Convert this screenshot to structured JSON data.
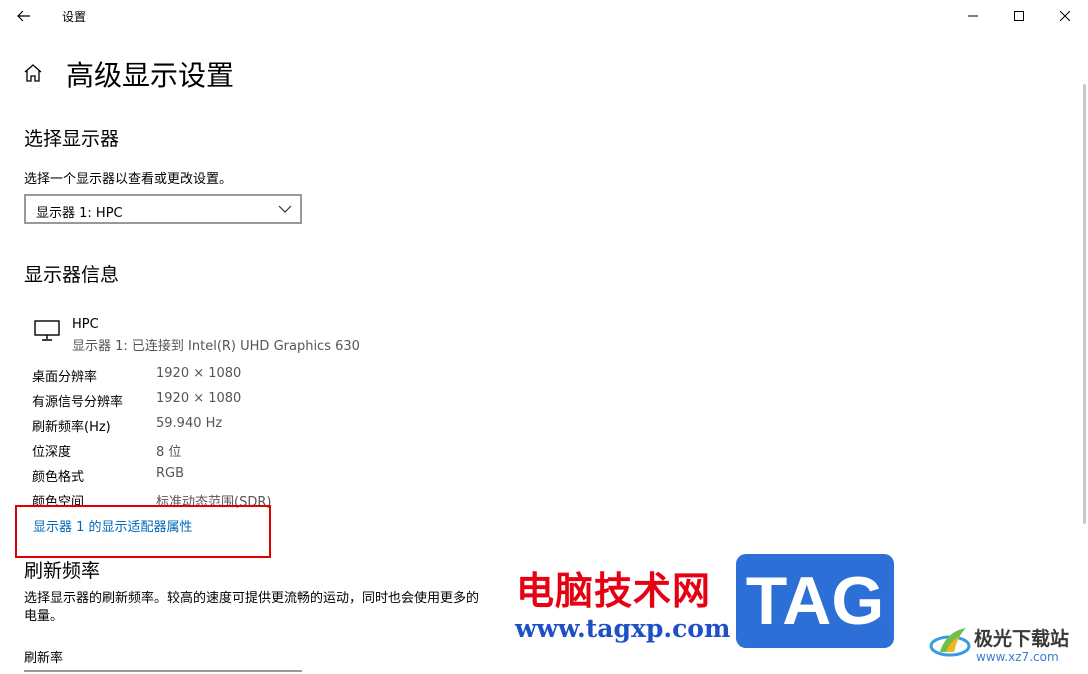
{
  "window": {
    "title": "设置"
  },
  "page": {
    "title": "高级显示设置"
  },
  "select_display": {
    "heading": "选择显示器",
    "description": "选择一个显示器以查看或更改设置。",
    "selected": "显示器 1: HPC"
  },
  "display_info": {
    "heading": "显示器信息",
    "monitor_name": "HPC",
    "monitor_subtitle": "显示器 1: 已连接到 Intel(R) UHD Graphics 630",
    "rows": [
      {
        "label": "桌面分辨率",
        "value": "1920 × 1080"
      },
      {
        "label": "有源信号分辨率",
        "value": "1920 × 1080"
      },
      {
        "label": "刷新频率(Hz)",
        "value": "59.940 Hz"
      },
      {
        "label": "位深度",
        "value": "8 位"
      },
      {
        "label": "颜色格式",
        "value": "RGB"
      },
      {
        "label": "颜色空间",
        "value": "标准动态范围(SDR)"
      }
    ],
    "adapter_link": "显示器 1 的显示适配器属性"
  },
  "refresh_rate": {
    "heading": "刷新频率",
    "description": "选择显示器的刷新频率。较高的速度可提供更流畅的运动，同时也会使用更多的电量。",
    "label": "刷新率"
  },
  "watermark": {
    "site_name": "电脑技术网",
    "site_url": "www.tagxp.com",
    "tag": "TAG",
    "brand2_name": "极光下载站",
    "brand2_url": "www.xz7.com"
  },
  "colors": {
    "link": "#0067b8",
    "annotation": "#e00000",
    "watermark_red": "#e60012",
    "watermark_blue": "#2c6fd6"
  }
}
